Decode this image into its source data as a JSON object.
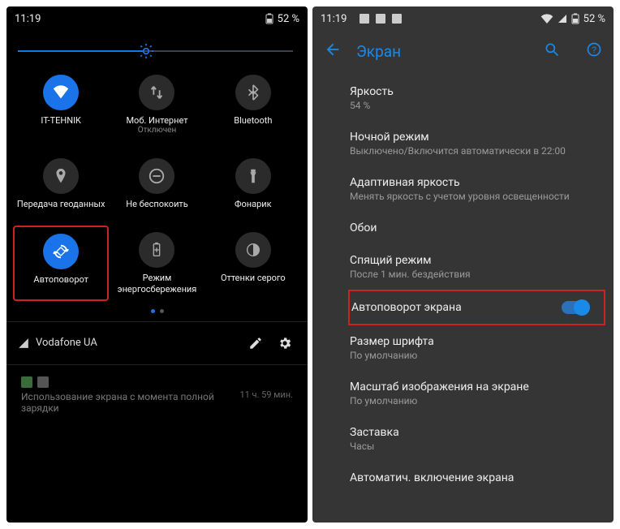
{
  "left": {
    "status": {
      "time": "11:19",
      "battery": "52 %"
    },
    "brightness_pct": 46,
    "tiles": [
      {
        "icon": "wifi",
        "active": true,
        "label": "IT-TEHNIK",
        "sub": ""
      },
      {
        "icon": "mobile-data",
        "active": false,
        "label": "Моб. Интернет",
        "sub": "Отключен"
      },
      {
        "icon": "bluetooth",
        "active": false,
        "label": "Bluetooth",
        "sub": ""
      },
      {
        "icon": "location",
        "active": false,
        "label": "Передача геоданных",
        "sub": ""
      },
      {
        "icon": "dnd",
        "active": false,
        "label": "Не беспокоить",
        "sub": ""
      },
      {
        "icon": "flashlight",
        "active": false,
        "label": "Фонарик",
        "sub": ""
      },
      {
        "icon": "autorotate",
        "active": true,
        "label": "Автоповорот",
        "sub": "",
        "highlight": true
      },
      {
        "icon": "battery-saver",
        "active": false,
        "label": "Режим энергосбережения",
        "sub": ""
      },
      {
        "icon": "grayscale",
        "active": false,
        "label": "Оттенки серого",
        "sub": ""
      }
    ],
    "carrier": "Vodafone UA",
    "notif": {
      "title": "Использование экрана с момента полной зарядки",
      "time": "11 ч. 59 мин."
    }
  },
  "right": {
    "status": {
      "time": "11:19",
      "battery": "52 %"
    },
    "title": "Экран",
    "items": [
      {
        "title": "Яркость",
        "sub": "54 %"
      },
      {
        "title": "Ночной режим",
        "sub": "Выключено/Включится автоматически в 22:00"
      },
      {
        "title": "Адаптивная яркость",
        "sub": "Менять яркость с учетом уровня освещенности"
      },
      {
        "title": "Обои",
        "sub": ""
      },
      {
        "title": "Спящий режим",
        "sub": "После 1 мин. бездействия"
      },
      {
        "title": "Автоповорот экрана",
        "sub": "",
        "toggle": true,
        "highlight": true
      },
      {
        "title": "Размер шрифта",
        "sub": "По умолчанию"
      },
      {
        "title": "Масштаб изображения на экране",
        "sub": "По умолчанию"
      },
      {
        "title": "Заставка",
        "sub": "Часы"
      },
      {
        "title": "Автоматич. включение экрана",
        "sub": ""
      }
    ]
  }
}
